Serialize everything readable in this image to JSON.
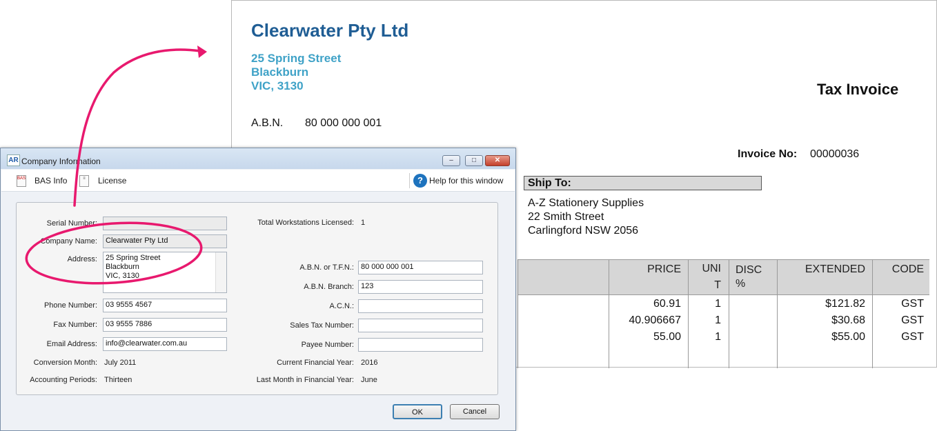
{
  "invoice": {
    "company_name": "Clearwater Pty Ltd",
    "address_lines": [
      "25 Spring Street",
      "Blackburn",
      "VIC, 3130"
    ],
    "title": "Tax Invoice",
    "abn_label": "A.B.N.",
    "abn_value": "80 000 000 001",
    "invoice_no_label": "Invoice No:",
    "invoice_no_value": "00000036",
    "ship_to_label": "Ship To:",
    "ship_to_lines": [
      "A-Z Stationery Supplies",
      "22 Smith Street",
      "Carlingford  NSW  2056"
    ],
    "table": {
      "headers": [
        "PRICE",
        "UNI T",
        "DISC %",
        "EXTENDED",
        "CODE"
      ],
      "rows": [
        [
          "60.91",
          "1",
          "",
          "$121.82",
          "GST"
        ],
        [
          "40.906667",
          "1",
          "",
          "$30.68",
          "GST"
        ],
        [
          "55.00",
          "1",
          "",
          "$55.00",
          "GST"
        ]
      ]
    }
  },
  "dialog": {
    "app_icon_text": "AR",
    "title": "Company Information",
    "window_buttons": {
      "minimize": "–",
      "maximize": "□",
      "close": "✕"
    },
    "toolbar": {
      "bas_info_label": "BAS Info",
      "license_label": "License",
      "help_label": "Help for this window"
    },
    "fields": {
      "serial_number": {
        "label": "Serial Number:",
        "value": ""
      },
      "company_name": {
        "label": "Company Name:",
        "value": "Clearwater Pty Ltd"
      },
      "address": {
        "label": "Address:",
        "lines": [
          "25 Spring Street",
          "Blackburn",
          "VIC, 3130"
        ]
      },
      "phone_number": {
        "label": "Phone Number:",
        "value": "03 9555 4567"
      },
      "fax_number": {
        "label": "Fax Number:",
        "value": "03 9555 7886"
      },
      "email_address": {
        "label": "Email Address:",
        "value": "info@clearwater.com.au"
      },
      "conversion_month": {
        "label": "Conversion Month:",
        "value": "July 2011"
      },
      "accounting_periods": {
        "label": "Accounting Periods:",
        "value": "Thirteen"
      },
      "total_workstations": {
        "label": "Total Workstations Licensed:",
        "value": "1"
      },
      "abn_tfn": {
        "label": "A.B.N. or T.F.N.:",
        "value": "80 000 000 001"
      },
      "abn_branch": {
        "label": "A.B.N. Branch:",
        "value": "123"
      },
      "acn": {
        "label": "A.C.N.:",
        "value": ""
      },
      "sales_tax_number": {
        "label": "Sales Tax Number:",
        "value": ""
      },
      "payee_number": {
        "label": "Payee Number:",
        "value": ""
      },
      "current_financial_year": {
        "label": "Current Financial Year:",
        "value": "2016"
      },
      "last_month_financial_year": {
        "label": "Last Month in Financial Year:",
        "value": "June"
      }
    },
    "ok_label": "OK",
    "cancel_label": "Cancel"
  },
  "colors": {
    "company_blue": "#1f5d94",
    "address_cyan": "#3fa2c7",
    "annotation_pink": "#e8196e"
  }
}
